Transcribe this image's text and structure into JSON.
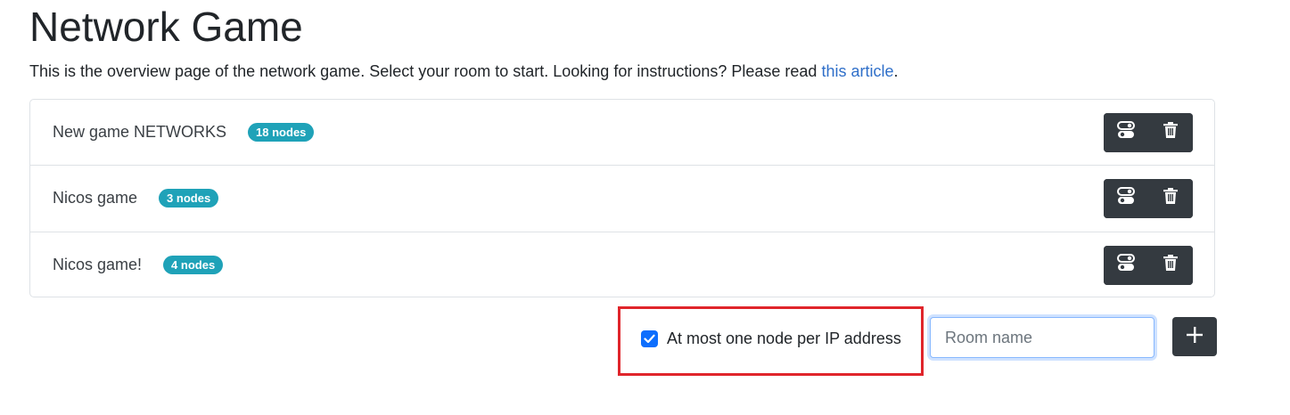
{
  "header": {
    "title": "Network Game",
    "intro_text": "This is the overview page of the network game. Select your room to start. Looking for instructions? Please read ",
    "intro_link": "this article",
    "intro_end": "."
  },
  "rooms": [
    {
      "name": "New game NETWORKS",
      "badge": "18 nodes"
    },
    {
      "name": "Nicos game",
      "badge": "3 nodes"
    },
    {
      "name": "Nicos game!",
      "badge": "4 nodes"
    }
  ],
  "controls": {
    "checkbox_label": "At most one node per IP address",
    "checkbox_checked": true,
    "room_name_placeholder": "Room name",
    "room_name_value": ""
  },
  "icons": {
    "toggle": "toggle-icon",
    "delete": "trash-icon",
    "add": "plus-icon",
    "check": "check-icon"
  },
  "colors": {
    "badge": "#1fa2b8",
    "dark_button": "#343a40",
    "checkbox": "#0d6efd",
    "highlight": "#e0252b",
    "link": "#2f6fc9"
  }
}
